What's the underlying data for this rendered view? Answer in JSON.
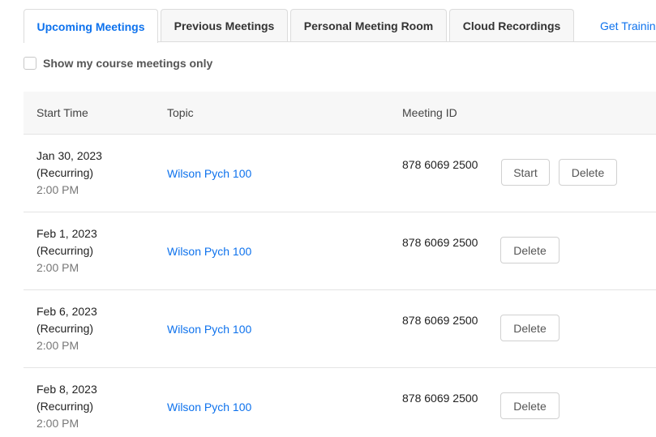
{
  "tabs": [
    {
      "label": "Upcoming Meetings",
      "active": true
    },
    {
      "label": "Previous Meetings",
      "active": false
    },
    {
      "label": "Personal Meeting Room",
      "active": false
    },
    {
      "label": "Cloud Recordings",
      "active": false
    }
  ],
  "training_link": "Get Training",
  "filter": {
    "label": "Show my course meetings only",
    "checked": false
  },
  "table": {
    "headers": {
      "start_time": "Start Time",
      "topic": "Topic",
      "meeting_id": "Meeting ID"
    },
    "rows": [
      {
        "date": "Jan 30, 2023 (Recurring)",
        "time": "2:00 PM",
        "topic": "Wilson Pych 100",
        "meeting_id": "878 6069 2500",
        "start_label": "Start",
        "delete_label": "Delete"
      },
      {
        "date": "Feb 1, 2023 (Recurring)",
        "time": "2:00 PM",
        "topic": "Wilson Pych 100",
        "meeting_id": "878 6069 2500",
        "delete_label": "Delete"
      },
      {
        "date": "Feb 6, 2023 (Recurring)",
        "time": "2:00 PM",
        "topic": "Wilson Pych 100",
        "meeting_id": "878 6069 2500",
        "delete_label": "Delete"
      },
      {
        "date": "Feb 8, 2023 (Recurring)",
        "time": "2:00 PM",
        "topic": "Wilson Pych 100",
        "meeting_id": "878 6069 2500",
        "delete_label": "Delete"
      }
    ]
  },
  "colors": {
    "accent": "#0e72ed",
    "header_bg": "#f7f7f7",
    "border": "#dcdcdc"
  }
}
